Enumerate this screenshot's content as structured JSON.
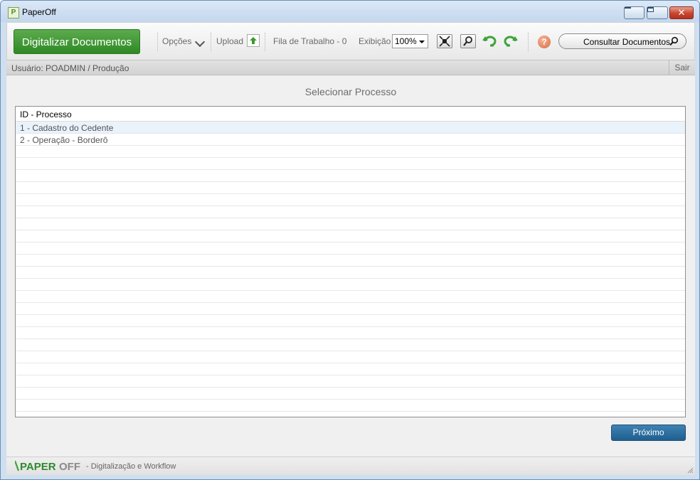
{
  "window": {
    "title": "PaperOff"
  },
  "toolbar": {
    "scan_label": "Digitalizar Documentos",
    "options_label": "Opções",
    "upload_label": "Upload",
    "queue_label": "Fila de Trabalho - 0",
    "view_label": "Exibição",
    "zoom_value": "100%",
    "search_label": "Consultar Documentos"
  },
  "status": {
    "user_text": "Usuário: POADMIN / Produção",
    "logout_label": "Sair"
  },
  "main": {
    "heading": "Selecionar Processo",
    "column_header": "ID - Processo",
    "rows": [
      "1 - Cadastro do Cedente",
      "2 - Operação - Borderô"
    ],
    "next_label": "Próximo"
  },
  "footer": {
    "brand_main": "PAPER",
    "brand_accent": "OFF",
    "tagline": "- Digitalização e Workflow"
  },
  "colors": {
    "primary_green": "#2f8a25",
    "next_blue": "#1f5f8f",
    "selected_row": "#eaf2fa"
  }
}
